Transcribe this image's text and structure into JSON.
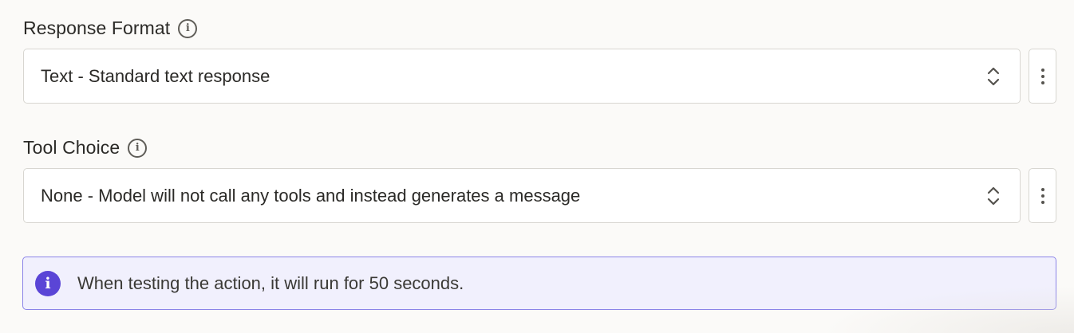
{
  "response_format": {
    "label": "Response Format",
    "info_icon": "info-icon",
    "selected_value": "Text - Standard text response"
  },
  "tool_choice": {
    "label": "Tool Choice",
    "info_icon": "info-icon",
    "selected_value": "None - Model will not call any tools and instead generates a message"
  },
  "notice": {
    "icon": "info-icon",
    "text": "When testing the action, it will run for 50 seconds.",
    "accent": "#5a45d6"
  }
}
